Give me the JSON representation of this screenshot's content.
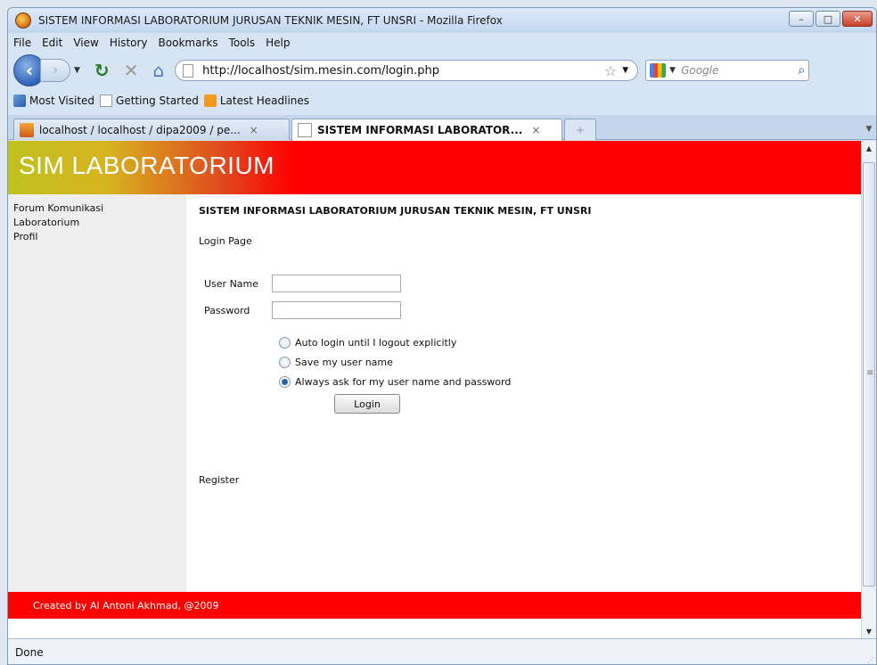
{
  "window": {
    "title": "SISTEM INFORMASI LABORATORIUM JURUSAN TEKNIK MESIN, FT UNSRI - Mozilla Firefox",
    "minimize": "–",
    "maximize": "□",
    "close": "✕"
  },
  "menu": [
    "File",
    "Edit",
    "View",
    "History",
    "Bookmarks",
    "Tools",
    "Help"
  ],
  "nav": {
    "url": "http://localhost/sim.mesin.com/login.php",
    "search_placeholder": "Google"
  },
  "bookmarks": [
    "Most Visited",
    "Getting Started",
    "Latest Headlines"
  ],
  "tabs": [
    {
      "label": "localhost / localhost / dipa2009 / pe...",
      "close": "×"
    },
    {
      "label": "SISTEM INFORMASI LABORATOR...",
      "close": "×"
    }
  ],
  "site": {
    "logo": "SIM LABORATORIUM",
    "sidebar": [
      "Forum Komunikasi",
      "Laboratorium",
      "Profil"
    ],
    "heading": "SISTEM INFORMASI LABORATORIUM JURUSAN TEKNIK MESIN, FT UNSRI",
    "subtitle": "Login Page",
    "username_label": "User Name",
    "password_label": "Password",
    "options": [
      {
        "label": "Auto login until I logout explicitly",
        "checked": false
      },
      {
        "label": "Save my user name",
        "checked": false
      },
      {
        "label": "Always ask for my user name and password",
        "checked": true
      }
    ],
    "login_button": "Login",
    "register": "Register",
    "footer": "Created by Al Antoni Akhmad, @2009"
  },
  "status": "Done"
}
